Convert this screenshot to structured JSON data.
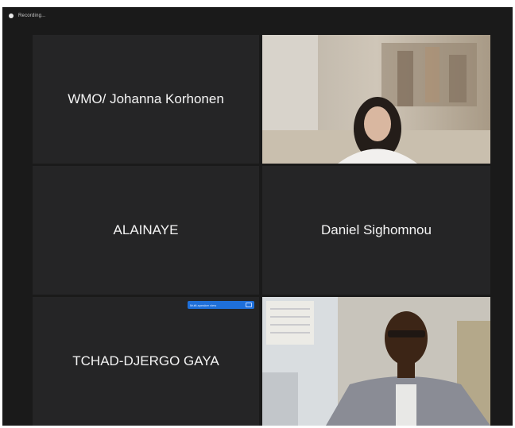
{
  "meeting": {
    "recording_label": "Recording..."
  },
  "participants": [
    {
      "name": "WMO/ Johanna Korhonen",
      "video": false
    },
    {
      "name": "",
      "video": true
    },
    {
      "name": "ALAINAYE",
      "video": false
    },
    {
      "name": "Daniel Sighomnou",
      "video": false
    },
    {
      "name": "TCHAD-DJERGO GAYA",
      "video": false
    },
    {
      "name": "",
      "video": true
    }
  ],
  "pin_prompt": {
    "label": "Multi-speaker view",
    "icon": "pin-video-icon",
    "color": "#1e6fd9"
  },
  "icons": {
    "recording": "recording-dot-icon"
  }
}
